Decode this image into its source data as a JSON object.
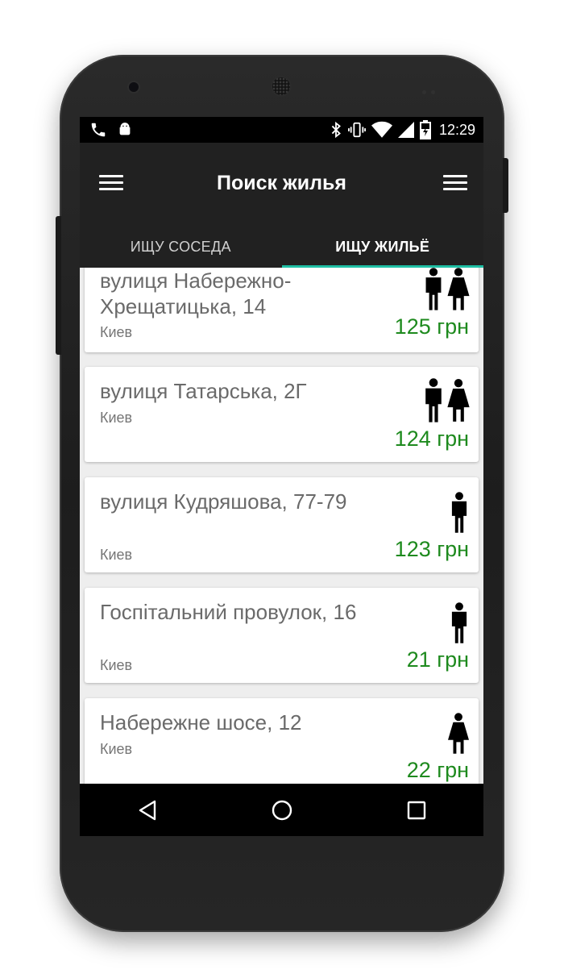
{
  "statusbar": {
    "time": "12:29"
  },
  "appbar": {
    "title": "Поиск жилья"
  },
  "tabs": [
    {
      "label": "ИЩУ СОСЕДА",
      "active": false
    },
    {
      "label": "ИЩУ ЖИЛЬЁ",
      "active": true
    }
  ],
  "listings": [
    {
      "address": "вулиця Набережно-Хрещатицька, 14",
      "city": "Киев",
      "price": "125 грн",
      "icon": "male-female-icon"
    },
    {
      "address": "вулиця Татарська, 2Г",
      "city": "Киев",
      "price": "124 грн",
      "icon": "male-female-icon"
    },
    {
      "address": "вулиця Кудряшова, 77-79",
      "city": "Киев",
      "price": "123 грн",
      "icon": "male-icon"
    },
    {
      "address": "Госпітальний провулок, 16",
      "city": "Киев",
      "price": "21 грн",
      "icon": "male-icon"
    },
    {
      "address": "Набережне шосе, 12",
      "city": "Киев",
      "price": "22 грн",
      "icon": "female-icon"
    }
  ],
  "colors": {
    "appbar": "#212121",
    "tab_indicator": "#1fbfa4",
    "price": "#1e8a1e"
  }
}
